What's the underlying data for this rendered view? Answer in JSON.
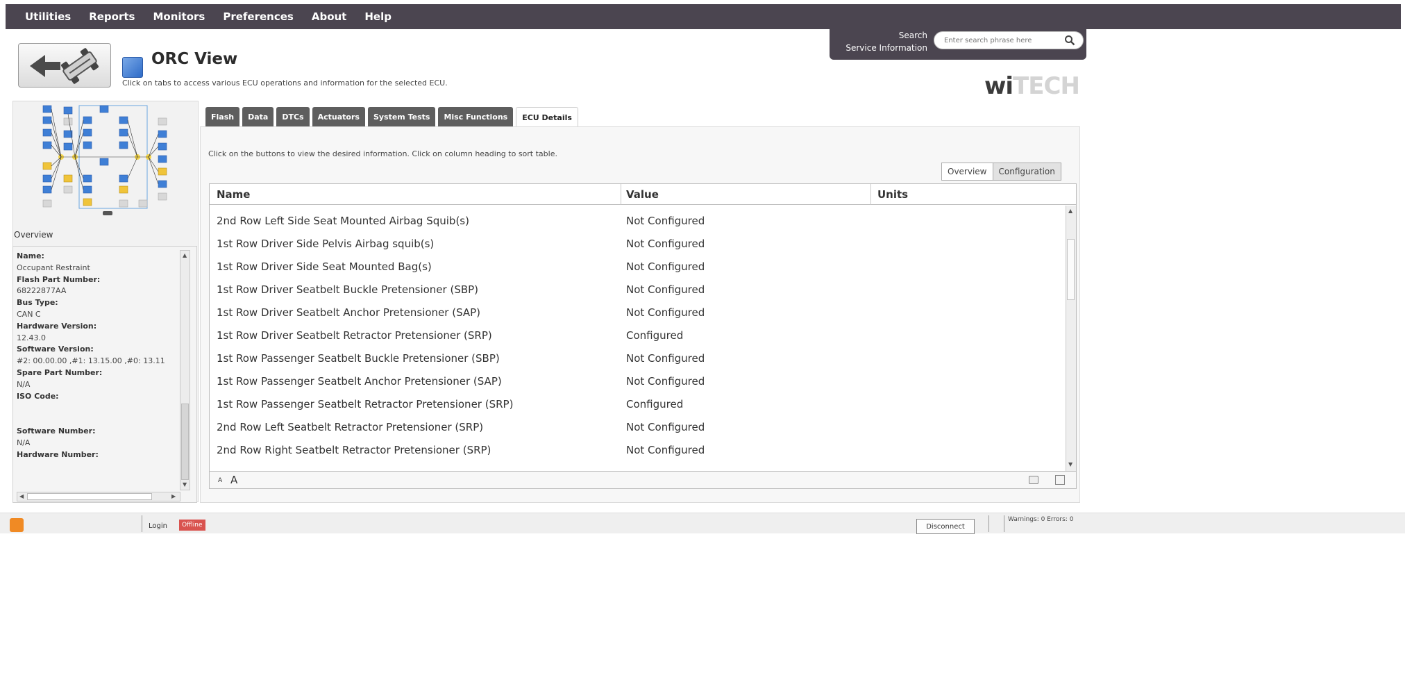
{
  "menu": [
    "Utilities",
    "Reports",
    "Monitors",
    "Preferences",
    "About",
    "Help"
  ],
  "search": {
    "label1": "Search",
    "label2": "Service Information",
    "placeholder": "Enter search phrase here"
  },
  "logo": {
    "main": "wi",
    "ghost": "TECH"
  },
  "header": {
    "title": "ORC View",
    "subtitle": "Click on tabs to access various ECU operations and information for the selected ECU."
  },
  "left": {
    "overview_label": "Overview",
    "fields": [
      {
        "label": "Name:",
        "value": "Occupant Restraint"
      },
      {
        "label": "Flash Part Number:",
        "value": "68222877AA"
      },
      {
        "label": "Bus Type:",
        "value": "CAN C"
      },
      {
        "label": "Hardware Version:",
        "value": "12.43.0"
      },
      {
        "label": "Software Version:",
        "value": "#2: 00.00.00 ,#1: 13.15.00 ,#0: 13.11"
      },
      {
        "label": "Spare Part Number:",
        "value": "N/A"
      },
      {
        "label": "ISO Code:",
        "value": ""
      },
      {
        "label": "Software Number:",
        "value": "N/A"
      },
      {
        "label": "Hardware Number:",
        "value": ""
      }
    ]
  },
  "tabs": [
    "Flash",
    "Data",
    "DTCs",
    "Actuators",
    "System Tests",
    "Misc Functions",
    "ECU Details"
  ],
  "active_tab": "ECU Details",
  "content": {
    "instructions": "Click on the buttons to view the desired information.  Click on column heading to sort table.",
    "view_buttons": [
      "Overview",
      "Configuration"
    ],
    "columns": [
      "Name",
      "Value",
      "Units"
    ],
    "rows": [
      {
        "name": "2nd Row Left Side Seat Mounted Airbag Squib(s)",
        "value": "Not Configured"
      },
      {
        "name": "1st Row Driver Side Pelvis Airbag squib(s)",
        "value": "Not Configured"
      },
      {
        "name": "1st Row Driver Side Seat Mounted Bag(s)",
        "value": "Not Configured"
      },
      {
        "name": "1st Row Driver Seatbelt Buckle Pretensioner (SBP)",
        "value": "Not Configured"
      },
      {
        "name": "1st Row Driver Seatbelt Anchor Pretensioner (SAP)",
        "value": "Not Configured"
      },
      {
        "name": "1st Row Driver Seatbelt Retractor Pretensioner (SRP)",
        "value": "Configured"
      },
      {
        "name": "1st Row Passenger Seatbelt Buckle Pretensioner (SBP)",
        "value": "Not Configured"
      },
      {
        "name": "1st Row Passenger Seatbelt Anchor Pretensioner (SAP)",
        "value": "Not Configured"
      },
      {
        "name": "1st Row Passenger Seatbelt Retractor Pretensioner (SRP)",
        "value": "Configured"
      },
      {
        "name": "2nd Row Left Seatbelt Retractor Pretensioner (SRP)",
        "value": "Not Configured"
      },
      {
        "name": "2nd Row Right Seatbelt Retractor Pretensioner (SRP)",
        "value": "Not Configured"
      }
    ],
    "font_small": "A",
    "font_large": "A"
  },
  "status": {
    "login": "Login",
    "offline": "Offline",
    "disconnect": "Disconnect",
    "warnings": "Warnings: 0 Errors: 0"
  }
}
